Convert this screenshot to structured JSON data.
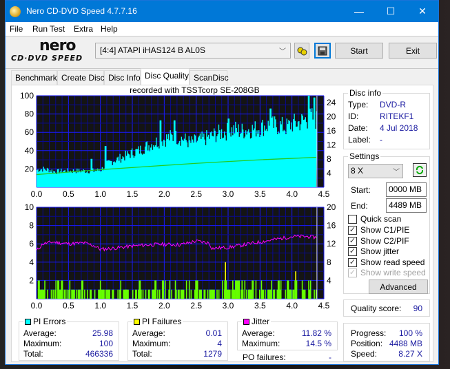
{
  "window": {
    "title": "Nero CD-DVD Speed 4.7.7.16",
    "controls": {
      "minimize": "—",
      "maximize": "☐",
      "close": "✕"
    }
  },
  "menu": [
    "File",
    "Run Test",
    "Extra",
    "Help"
  ],
  "toolbar": {
    "logo_main": "nero",
    "logo_sub": "CD·DVD SPEED",
    "drive": "[4:4]  ATAPI iHAS124   B AL0S",
    "start_label": "Start",
    "exit_label": "Exit",
    "icons": {
      "config": "drive-config-icon",
      "save": "save-icon"
    }
  },
  "tabs": [
    {
      "label": "Benchmark",
      "active": false
    },
    {
      "label": "Create Disc",
      "active": false
    },
    {
      "label": "Disc Info",
      "active": false
    },
    {
      "label": "Disc Quality",
      "active": true
    },
    {
      "label": "ScanDisc",
      "active": false
    }
  ],
  "chart_data": [
    {
      "type": "area",
      "title": "recorded with TSSTcorp SE-208GB",
      "xlabel": "",
      "ylabel": "",
      "xlim": [
        0,
        4.5
      ],
      "ylim": [
        0,
        100
      ],
      "y2lim": [
        0,
        26
      ],
      "x_ticks": [
        "0.0",
        "0.5",
        "1.0",
        "1.5",
        "2.0",
        "2.5",
        "3.0",
        "3.5",
        "4.0",
        "4.5"
      ],
      "y_ticks": [
        "20",
        "40",
        "60",
        "80",
        "100"
      ],
      "y2_ticks": [
        "4",
        "8",
        "12",
        "16",
        "20",
        "24"
      ],
      "grid": true,
      "series": [
        {
          "name": "PI Errors",
          "color": "#00ffff",
          "x": [
            0.0,
            0.1,
            0.2,
            0.3,
            0.4,
            0.5,
            0.6,
            0.7,
            0.8,
            0.9,
            1.0,
            1.1,
            1.2,
            1.3,
            1.4,
            1.5,
            1.6,
            1.7,
            1.8,
            1.9,
            2.0,
            2.1,
            2.2,
            2.3,
            2.4,
            2.5,
            2.6,
            2.7,
            2.8,
            2.9,
            3.0,
            3.1,
            3.2,
            3.3,
            3.4,
            3.5,
            3.6,
            3.7,
            3.8,
            3.9,
            4.0,
            4.1,
            4.2,
            4.3,
            4.38
          ],
          "values": [
            18,
            19,
            18,
            16,
            17,
            17,
            17,
            17,
            17,
            17,
            18,
            24,
            28,
            30,
            33,
            36,
            38,
            42,
            45,
            48,
            50,
            52,
            52,
            50,
            46,
            48,
            50,
            52,
            55,
            57,
            58,
            60,
            58,
            60,
            60,
            62,
            64,
            64,
            64,
            62,
            66,
            67,
            70,
            72,
            70
          ],
          "peaks": [
            [
              0.85,
              31
            ],
            [
              1.07,
              45
            ],
            [
              1.93,
              73
            ],
            [
              2.15,
              73
            ],
            [
              3.0,
              75
            ],
            [
              3.65,
              86
            ],
            [
              4.25,
              100
            ],
            [
              4.35,
              98
            ]
          ]
        },
        {
          "name": "Read speed",
          "color": "#22cc22",
          "axis": "right",
          "x": [
            0.0,
            0.5,
            1.0,
            1.5,
            2.0,
            2.5,
            3.0,
            3.5,
            4.0,
            4.38
          ],
          "values": [
            3.6,
            4.3,
            5.0,
            5.6,
            6.2,
            6.8,
            7.3,
            7.8,
            8.2,
            8.5
          ]
        }
      ]
    },
    {
      "type": "bar",
      "xlim": [
        0,
        4.5
      ],
      "ylim": [
        0,
        10
      ],
      "y2lim": [
        0,
        20
      ],
      "x_ticks": [
        "0.0",
        "0.5",
        "1.0",
        "1.5",
        "2.0",
        "2.5",
        "3.0",
        "3.5",
        "4.0",
        "4.5"
      ],
      "y_ticks": [
        "2",
        "4",
        "6",
        "8",
        "10"
      ],
      "y2_ticks": [
        "4",
        "8",
        "12",
        "16",
        "20"
      ],
      "grid": true,
      "series": [
        {
          "name": "PI Failures",
          "color": "#66ff00",
          "note": "mostly values of 1 and 2 across the disc",
          "spikes": [
            [
              2.95,
              4
            ],
            [
              4.05,
              3
            ]
          ],
          "spike_color": "#ffff00"
        },
        {
          "name": "Jitter",
          "color": "#ff00ff",
          "axis": "right",
          "x": [
            0.0,
            0.1,
            0.25,
            0.5,
            0.75,
            0.9,
            1.0,
            1.25,
            1.5,
            1.75,
            2.0,
            2.25,
            2.5,
            2.7,
            2.75,
            3.0,
            3.25,
            3.5,
            3.75,
            4.0,
            4.25,
            4.38
          ],
          "values": [
            10.5,
            12.0,
            12.4,
            12.0,
            12.2,
            11.6,
            10.8,
            11.1,
            11.5,
            11.8,
            11.9,
            11.8,
            12.6,
            12.2,
            11.0,
            11.2,
            11.8,
            12.4,
            13.0,
            13.6,
            13.6,
            13.4
          ]
        }
      ]
    }
  ],
  "disc_info": {
    "title": "Disc info",
    "rows": [
      {
        "label": "Type:",
        "value": "DVD-R"
      },
      {
        "label": "ID:",
        "value": "RITEKF1"
      },
      {
        "label": "Date:",
        "value": "4 Jul 2018"
      },
      {
        "label": "Label:",
        "value": "-"
      }
    ]
  },
  "settings": {
    "title": "Settings",
    "speed": "8 X",
    "start_label": "Start:",
    "start_value": "0000 MB",
    "end_label": "End:",
    "end_value": "4489 MB",
    "checkboxes": [
      {
        "label": "Quick scan",
        "checked": false,
        "enabled": true
      },
      {
        "label": "Show C1/PIE",
        "checked": true,
        "enabled": true
      },
      {
        "label": "Show C2/PIF",
        "checked": true,
        "enabled": true
      },
      {
        "label": "Show jitter",
        "checked": true,
        "enabled": true
      },
      {
        "label": "Show read speed",
        "checked": true,
        "enabled": true
      },
      {
        "label": "Show write speed",
        "checked": true,
        "enabled": false
      }
    ],
    "advanced_label": "Advanced"
  },
  "quality": {
    "label": "Quality score:",
    "value": "90"
  },
  "progress": {
    "rows": [
      {
        "label": "Progress:",
        "value": "100 %"
      },
      {
        "label": "Position:",
        "value": "4488 MB"
      },
      {
        "label": "Speed:",
        "value": "8.27 X"
      }
    ]
  },
  "stats": {
    "pi_errors": {
      "title": "PI Errors",
      "color": "#00ffff",
      "average_label": "Average:",
      "average": "25.98",
      "maximum_label": "Maximum:",
      "maximum": "100",
      "total_label": "Total:",
      "total": "466336"
    },
    "pi_failures": {
      "title": "PI Failures",
      "color": "#ffff00",
      "average_label": "Average:",
      "average": "0.01",
      "maximum_label": "Maximum:",
      "maximum": "4",
      "total_label": "Total:",
      "total": "1279"
    },
    "jitter": {
      "title": "Jitter",
      "color": "#ff00ff",
      "average_label": "Average:",
      "average": "11.82 %",
      "maximum_label": "Maximum:",
      "maximum": "14.5 %"
    },
    "po_failures_label": "PO failures:",
    "po_failures": "-"
  }
}
